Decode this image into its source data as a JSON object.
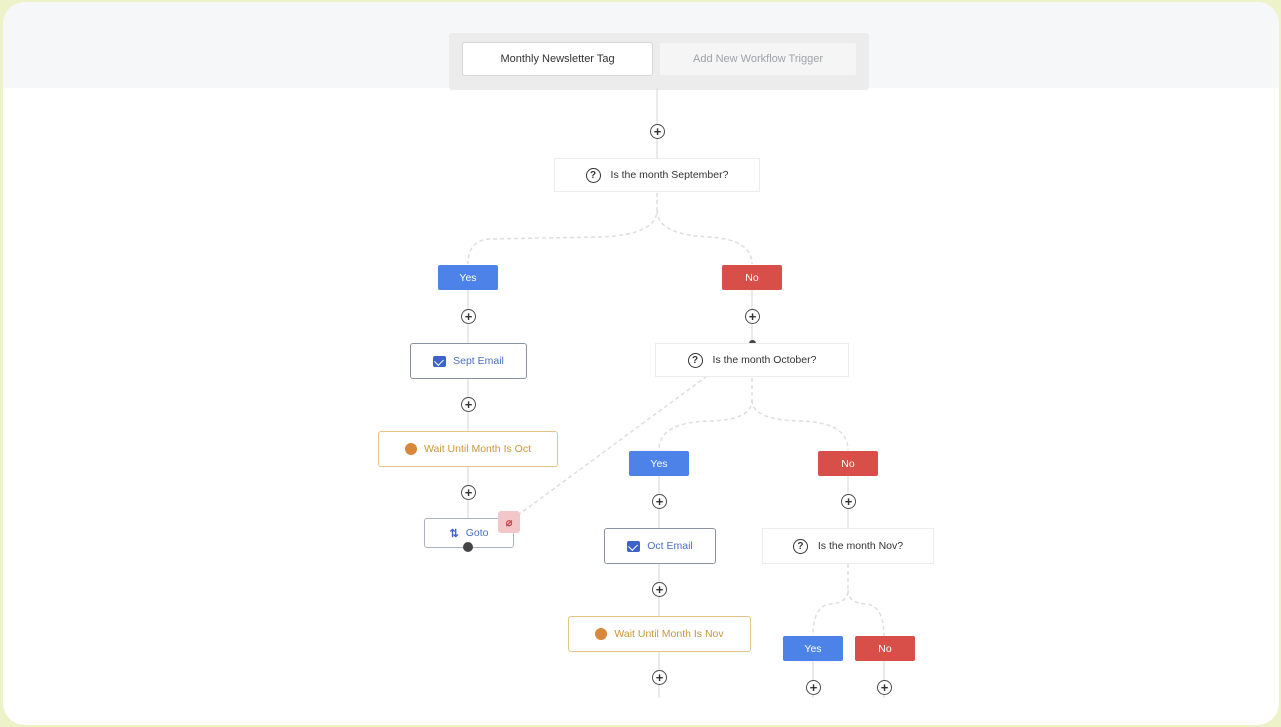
{
  "triggers": {
    "primary": "Monthly Newsletter Tag",
    "add": "Add New Workflow Trigger"
  },
  "plus_symbol": "+",
  "conditions": {
    "september": "Is the month September?",
    "october": "Is the month October?",
    "november": "Is the month Nov?"
  },
  "question_icon": "?",
  "branches": {
    "yes": "Yes",
    "no": "No"
  },
  "actions": {
    "sept_email": "Sept Email",
    "wait_oct": "Wait Until Month Is Oct",
    "goto": "Goto",
    "oct_email": "Oct Email",
    "wait_nov": "Wait Until Month Is Nov"
  },
  "icons": {
    "email": "mail-icon",
    "wait": "clock-icon",
    "goto": "goto-icon",
    "unlink": "unlink-icon",
    "condition": "question-icon"
  },
  "goto_glyph": "⇅",
  "unlink_glyph": "⌀",
  "colors": {
    "yes": "#4d82e9",
    "no": "#d84e49",
    "wait_border": "#e3c585",
    "wait_text": "#c7973c",
    "email_icon": "#3d63c9",
    "background": "#eef2c9"
  }
}
